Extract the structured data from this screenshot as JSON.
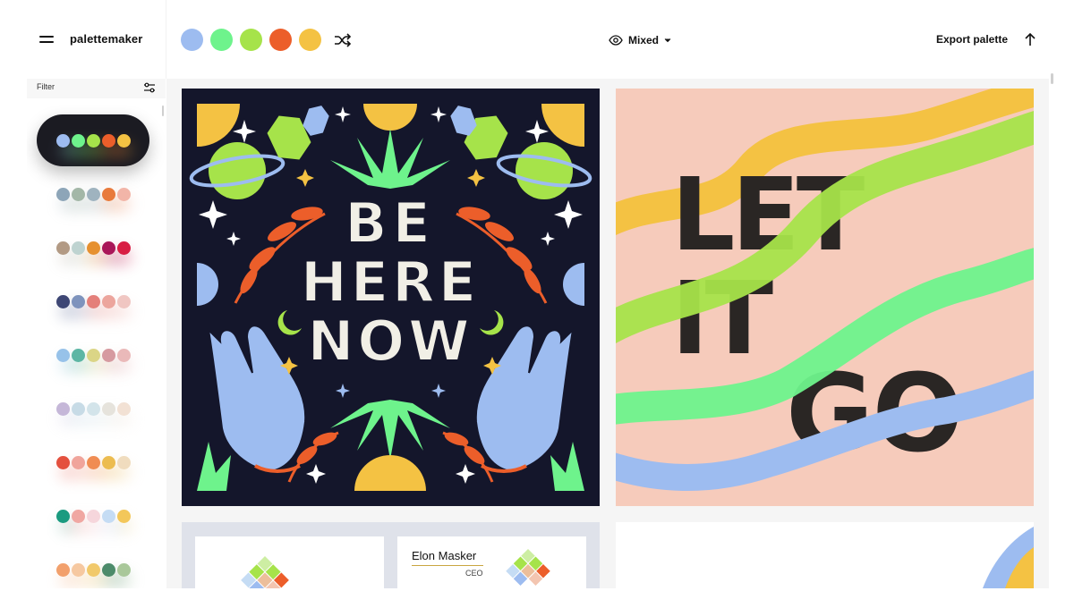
{
  "app": {
    "brand": "palettemaker"
  },
  "toolbar": {
    "palette_colors": [
      "#9dbcf0",
      "#6ef38c",
      "#a6e34a",
      "#ec5e2a",
      "#f4c243"
    ],
    "view_mode_label": "Mixed",
    "export_label": "Export palette",
    "icons": [
      "menu-icon",
      "shuffle-icon",
      "eye-icon",
      "chevron-down-icon",
      "arrow-up-icon"
    ]
  },
  "sidebar": {
    "filter_label": "Filter",
    "palettes": [
      [
        "#9dbcf0",
        "#6ef38c",
        "#a6e34a",
        "#ec5e2a",
        "#f4c243"
      ],
      [
        "#8da5b8",
        "#a3b7a7",
        "#9fb3bf",
        "#e87a3c",
        "#f2b5a8"
      ],
      [
        "#b29a84",
        "#bed3d0",
        "#e6902f",
        "#a91658",
        "#d81e44"
      ],
      [
        "#3d4674",
        "#7e93bd",
        "#e47f7a",
        "#eca59d",
        "#f0c6c2"
      ],
      [
        "#97c2e9",
        "#5db6a4",
        "#dbd586",
        "#d69aa0",
        "#eab9b9"
      ],
      [
        "#c5b7d8",
        "#c7dbe6",
        "#d3e4ea",
        "#e6e3dc",
        "#f2e1d4"
      ],
      [
        "#e4503e",
        "#f0a49b",
        "#f08c52",
        "#ecbc4f",
        "#f0dcbe"
      ],
      [
        "#1b9b80",
        "#f0a7a2",
        "#f6d6dc",
        "#c5dcf4",
        "#f3c75a"
      ],
      [
        "#f2a06c",
        "#f6c8a0",
        "#f1c96a",
        "#4c8b6a",
        "#a9c89a"
      ]
    ]
  },
  "gallery": {
    "art_1": {
      "lines": [
        "BE",
        "HERE",
        "NOW"
      ],
      "colors": {
        "bg": "#14162b",
        "green": "#6ef38c",
        "lime": "#a6e34a",
        "orange": "#ec5e2a",
        "yellow": "#f4c243",
        "blue": "#9dbcf0"
      }
    },
    "art_2": {
      "lines": [
        "LET",
        "IT",
        "GO"
      ],
      "colors": {
        "bg": "#f6cbbb",
        "ink": "#2a2624"
      }
    },
    "card_3": {
      "name": "Elon Masker",
      "role": "CEO"
    }
  }
}
